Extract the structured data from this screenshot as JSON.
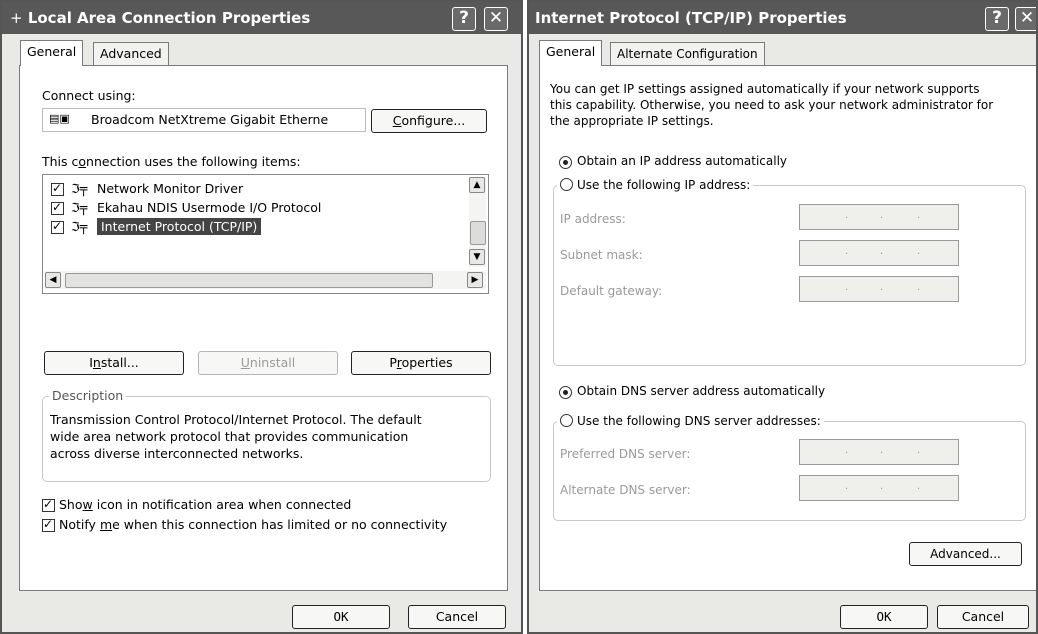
{
  "left_dialog": {
    "title": "Local Area Connection Properties",
    "title_glyph": "+",
    "help_btn": "?",
    "close_btn": "✕",
    "tabs": [
      "General",
      "Advanced"
    ],
    "connect_using_label": "Connect using:",
    "adapter_name": "Broadcom NetXtreme Gigabit Etherne",
    "configure_label": "Configure...",
    "items_label": "This connection uses the following items:",
    "items": [
      {
        "label": "Network Monitor Driver",
        "checked": true
      },
      {
        "label": "Ekahau NDIS Usermode I/O Protocol",
        "checked": true
      },
      {
        "label": "Internet Protocol (TCP/IP)",
        "checked": true,
        "selected": true
      }
    ],
    "install_label": "Install...",
    "uninstall_label": "Uninstall",
    "properties_label": "Properties",
    "description_legend": "Description",
    "description_text": [
      "Transmission Control Protocol/Internet Protocol. The default",
      "wide area network protocol that provides communication",
      "across diverse interconnected networks."
    ],
    "show_icon_label": "Show icon in notification area when connected",
    "notify_label": "Notify me when this connection has limited or no connectivity",
    "ok_label": "OK",
    "cancel_label": "Cancel"
  },
  "right_dialog": {
    "title": "Internet Protocol (TCP/IP) Properties",
    "help_btn": "?",
    "close_btn": "✕",
    "tabs": [
      "General",
      "Alternate Configuration"
    ],
    "intro_lines": [
      "You can get IP settings assigned automatically if your network supports",
      "this capability. Otherwise, you need to ask your network administrator for",
      "the appropriate IP settings."
    ],
    "obtain_ip_label": "Obtain an IP address automatically",
    "use_ip_label": "Use the following IP address:",
    "ip_address_label": "IP address:",
    "subnet_label": "Subnet mask:",
    "gateway_label": "Default gateway:",
    "obtain_dns_label": "Obtain DNS server address automatically",
    "use_dns_label": "Use the following DNS server addresses:",
    "preferred_dns_label": "Preferred DNS server:",
    "alternate_dns_label": "Alternate DNS server:",
    "ip_dots": ".",
    "advanced_label": "Advanced...",
    "ok_label": "OK",
    "cancel_label": "Cancel"
  }
}
